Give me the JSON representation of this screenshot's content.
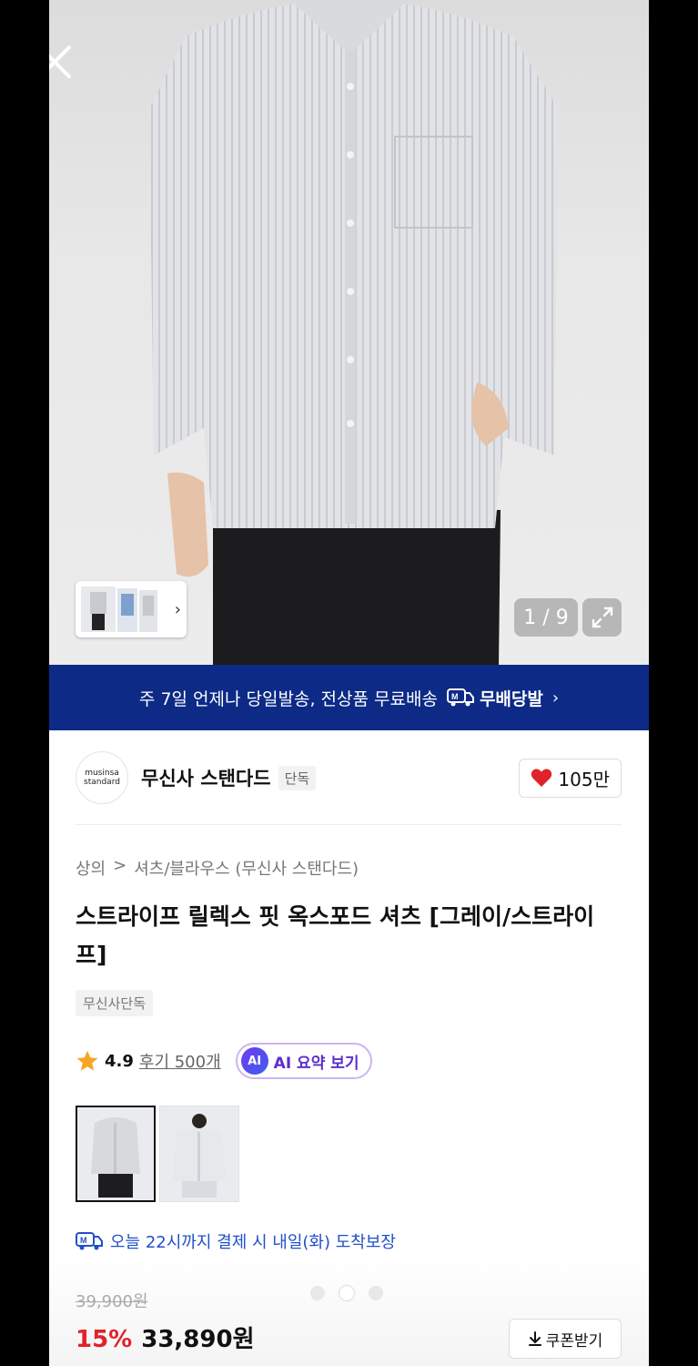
{
  "gallery": {
    "counter": "1 / 9"
  },
  "banner": {
    "text": "주 7일 언제나 당일발송, 전상품 무료배송",
    "brand_label": "무배당발",
    "chevron": "›"
  },
  "brand": {
    "logo_line1": "musinsa",
    "logo_line2": "standard",
    "name": "무신사 스탠다드",
    "badge": "단독",
    "likes": "105만"
  },
  "breadcrumb": {
    "level1": "상의",
    "separator": ">",
    "level2": "셔츠/블라우스 (무신사 스탠다드)"
  },
  "product": {
    "title": "스트라이프 릴렉스 핏 옥스포드 셔츠 [그레이/스트라이프]",
    "tag": "무신사단독",
    "rating": "4.9",
    "reviews": "후기 500개",
    "ai_badge": "AI",
    "ai_label": "AI 요약 보기",
    "delivery": "오늘 22시까지 결제 시 내일(화) 도착보장",
    "original_price": "39,900원",
    "discount": "15%",
    "price": "33,890원",
    "coupon_label": "쿠폰받기"
  },
  "colors": {
    "banner_bg": "#0c2a86",
    "discount": "#e0232a",
    "delivery": "#1f4fc9",
    "heart": "#e0232a",
    "star": "#f5a623"
  }
}
